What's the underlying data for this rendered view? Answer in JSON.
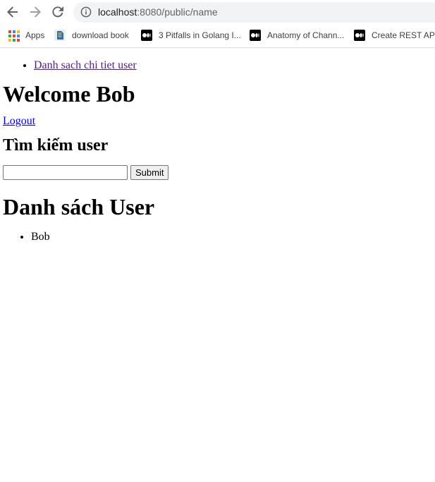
{
  "browser": {
    "url_host": "localhost",
    "url_path": ":8080/public/name",
    "bookmarks": [
      {
        "label": "Apps",
        "icon": "apps-icon"
      },
      {
        "label": "download book",
        "icon": "book-icon"
      },
      {
        "label": "3 Pitfalls in Golang I...",
        "icon": "medium-icon"
      },
      {
        "label": "Anatomy of Chann...",
        "icon": "medium-icon"
      },
      {
        "label": "Create REST API v",
        "icon": "medium-icon"
      }
    ]
  },
  "nav": {
    "link_label": "Danh sach chi tiet user"
  },
  "welcome": {
    "title": "Welcome Bob"
  },
  "logout": {
    "label": "Logout"
  },
  "search": {
    "title": "Tìm kiếm user",
    "input_value": "",
    "submit_label": "Submit"
  },
  "users": {
    "title": "Danh sách User",
    "items": [
      "Bob"
    ]
  },
  "colors": {
    "link": "#0000ee",
    "visited_link": "#551a8b"
  }
}
